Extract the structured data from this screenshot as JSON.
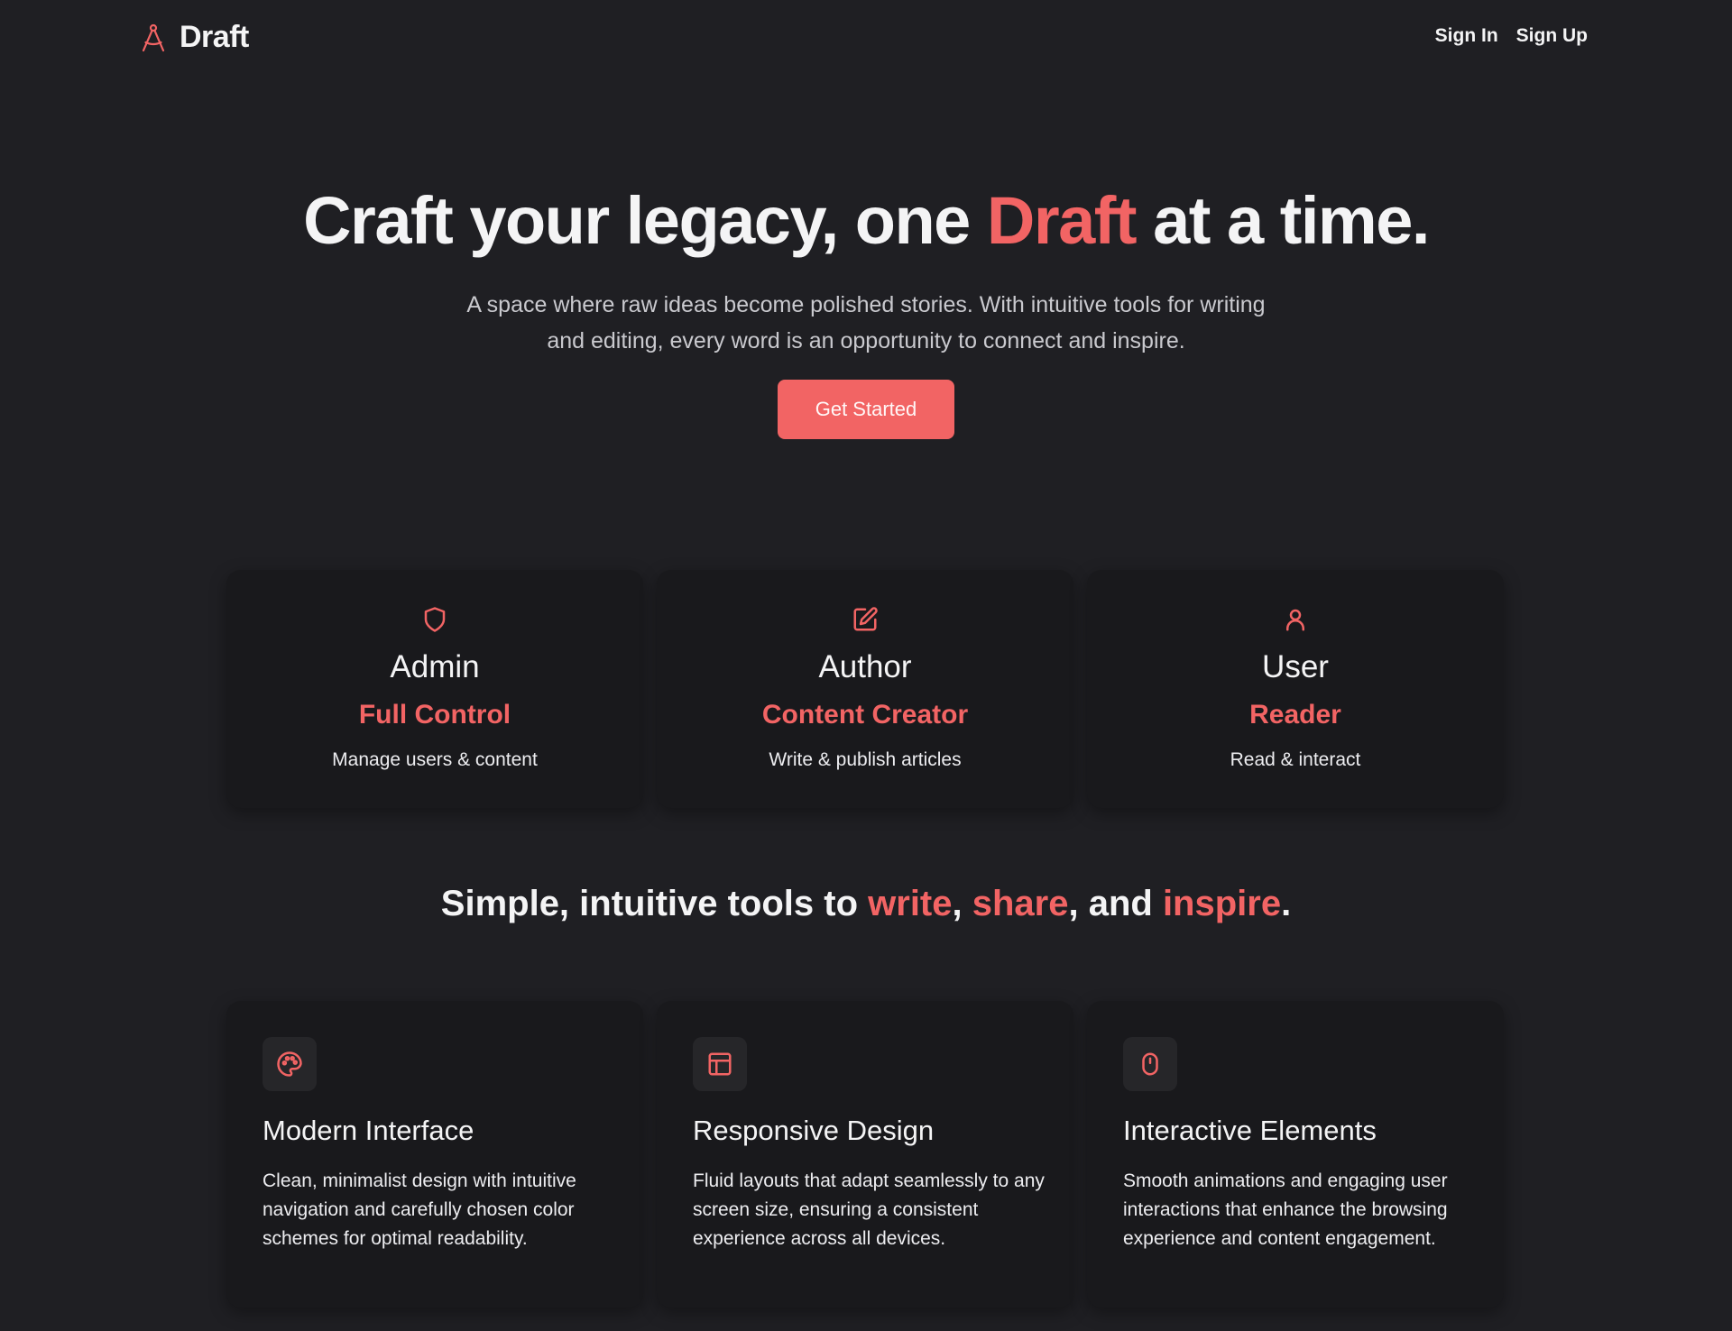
{
  "header": {
    "brand": "Draft",
    "nav": {
      "sign_in": "Sign In",
      "sign_up": "Sign Up"
    }
  },
  "hero": {
    "title_before": "Craft your legacy, one ",
    "title_accent": "Draft",
    "title_after": " at a time.",
    "subtitle": "A space where raw ideas become polished stories. With intuitive tools for writing and editing, every word is an opportunity to connect and inspire.",
    "cta": "Get Started"
  },
  "roles": [
    {
      "icon": "shield-icon",
      "title": "Admin",
      "subtitle": "Full Control",
      "description": "Manage users & content"
    },
    {
      "icon": "edit-icon",
      "title": "Author",
      "subtitle": "Content Creator",
      "description": "Write & publish articles"
    },
    {
      "icon": "user-icon",
      "title": "User",
      "subtitle": "Reader",
      "description": "Read & interact"
    }
  ],
  "tools_heading": {
    "prefix": "Simple, intuitive tools to ",
    "w1": "write",
    "sep1": ", ",
    "w2": "share",
    "sep2": ", and ",
    "w3": "inspire",
    "suffix": "."
  },
  "features": [
    {
      "icon": "palette-icon",
      "title": "Modern Interface",
      "description": "Clean, minimalist design with intuitive navigation and carefully chosen color schemes for optimal readability."
    },
    {
      "icon": "layout-icon",
      "title": "Responsive Design",
      "description": "Fluid layouts that adapt seamlessly to any screen size, ensuring a consistent experience across all devices."
    },
    {
      "icon": "mouse-icon",
      "title": "Interactive Elements",
      "description": "Smooth animations and engaging user interactions that enhance the browsing experience and content engagement."
    }
  ],
  "colors": {
    "accent": "#f26464",
    "background": "#1f1f23",
    "card": "#19191c",
    "text": "#f4f4f5"
  }
}
